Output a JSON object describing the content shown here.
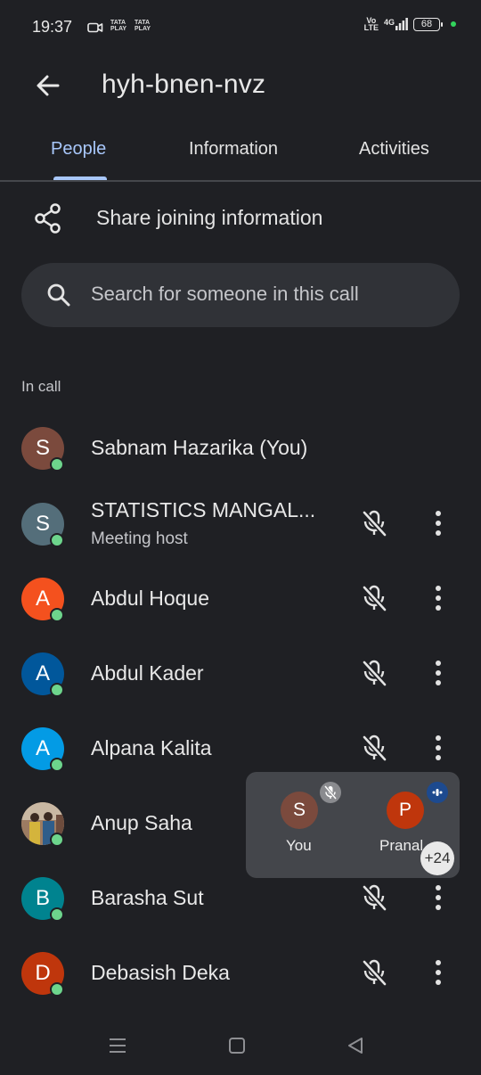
{
  "status_bar": {
    "time": "19:37",
    "provider_1_line1": "TATA",
    "provider_1_line2": "PLAY",
    "provider_2_line1": "TATA",
    "provider_2_line2": "PLAY",
    "volte_line1": "Vo",
    "volte_line2": "LTE",
    "network": "4G",
    "battery": "68"
  },
  "header": {
    "title": "hyh-bnen-nvz"
  },
  "tabs": [
    {
      "label": "People",
      "active": true
    },
    {
      "label": "Information",
      "active": false
    },
    {
      "label": "Activities",
      "active": false
    }
  ],
  "share": {
    "label": "Share joining information"
  },
  "search": {
    "placeholder": "Search for someone in this call"
  },
  "section_label": "In call",
  "participants": [
    {
      "initial": "S",
      "name": "Sabnam Hazarika (You)",
      "subtitle": "",
      "avatar_color": "#7b4a3d",
      "muted_icon": false,
      "more_icon": false
    },
    {
      "initial": "S",
      "name": "STATISTICS MANGAL...",
      "subtitle": "Meeting host",
      "avatar_color": "#546e7a",
      "muted_icon": true,
      "more_icon": true
    },
    {
      "initial": "A",
      "name": "Abdul Hoque",
      "subtitle": "",
      "avatar_color": "#f4511e",
      "muted_icon": true,
      "more_icon": true
    },
    {
      "initial": "A",
      "name": "Abdul Kader",
      "subtitle": "",
      "avatar_color": "#01579b",
      "muted_icon": true,
      "more_icon": true
    },
    {
      "initial": "A",
      "name": "Alpana Kalita",
      "subtitle": "",
      "avatar_color": "#039be5",
      "muted_icon": true,
      "more_icon": true
    },
    {
      "initial": "",
      "name": "Anup Saha",
      "subtitle": "",
      "avatar_color": "#b08a6a",
      "muted_icon": false,
      "more_icon": false
    },
    {
      "initial": "B",
      "name": "Barasha Sut",
      "subtitle": "",
      "avatar_color": "#00838f",
      "muted_icon": true,
      "more_icon": true
    },
    {
      "initial": "D",
      "name": "Debasish Deka",
      "subtitle": "",
      "avatar_color": "#bf360c",
      "muted_icon": true,
      "more_icon": true
    }
  ],
  "floating_tile": {
    "you_initial": "S",
    "you_label": "You",
    "you_color": "#7b4a3d",
    "other_initial": "P",
    "other_label": "Pranal",
    "other_color": "#bf360c",
    "extra_count": "+24"
  },
  "nav_bar": {
    "icons": [
      "menu-icon",
      "home-icon",
      "back-icon"
    ]
  }
}
